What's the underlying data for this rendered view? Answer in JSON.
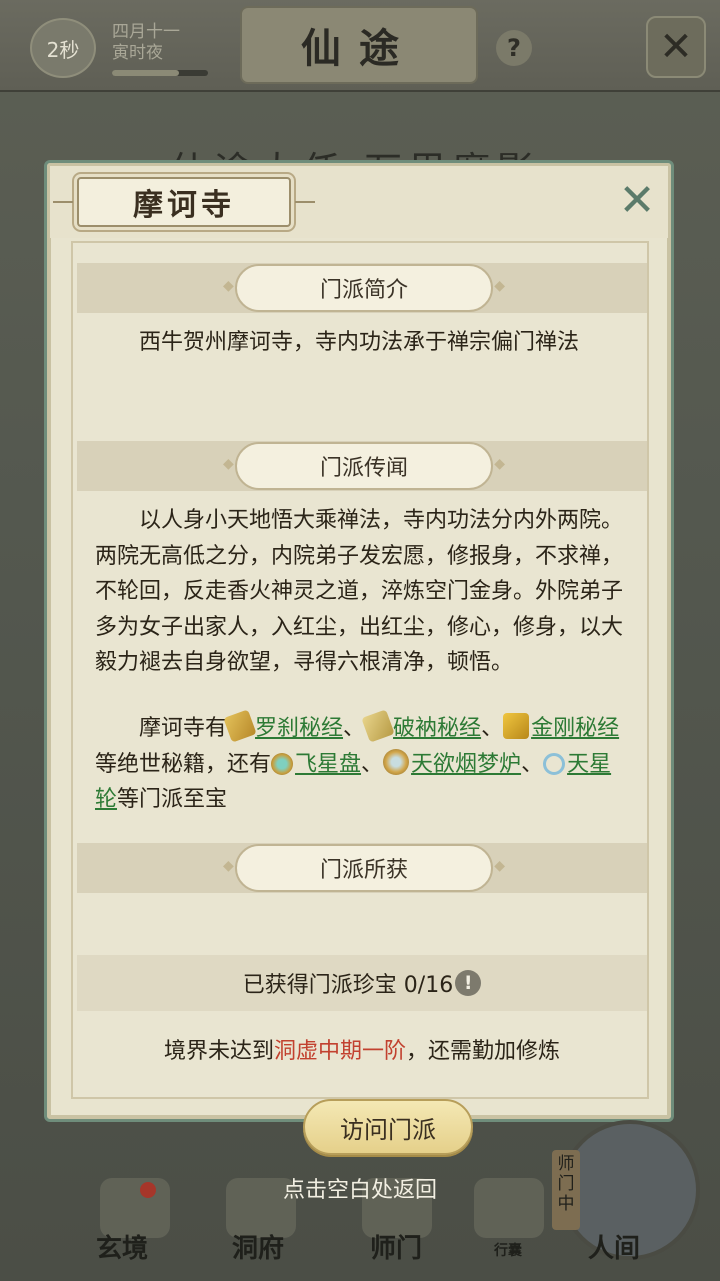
{
  "header": {
    "timer": "2秒",
    "date_line1": "四月十一",
    "date_line2": "寅时夜",
    "title": "仙途",
    "help": "?",
    "close": "✕"
  },
  "background": {
    "heading": "仙途大任 万里魔影"
  },
  "modal": {
    "title": "摩诃寺",
    "close": "✕",
    "sections": {
      "intro": {
        "label": "门派简介",
        "text": "西牛贺州摩诃寺，寺内功法承于禅宗偏门禅法"
      },
      "lore": {
        "label": "门派传闻",
        "text": "以人身小天地悟大乘禅法，寺内功法分内外两院。两院无高低之分，内院弟子发宏愿，修报身，不求禅，不轮回，反走香火神灵之道，淬炼空门金身。外院弟子多为女子出家人，入红尘，出红尘，修心，修身，以大毅力褪去自身欲望，寻得六根清净，顿悟。",
        "treasure_prefix": "摩诃寺有",
        "scrolls": [
          "罗刹秘经",
          "破衲秘经",
          "金刚秘经"
        ],
        "mid_text": "等绝世秘籍，还有",
        "treasures": [
          "飞星盘",
          "天欲烟梦炉",
          "天星轮"
        ],
        "end_text": "等门派至宝",
        "sep": "、"
      },
      "gains": {
        "label": "门派所获",
        "text": "已获得门派珍宝 0/16",
        "warn": "!"
      }
    },
    "realm": {
      "prefix": "境界未达到",
      "required": "洞虚中期一阶",
      "suffix": "，还需勤加修炼"
    },
    "visit_button": "访问门派"
  },
  "bottom": {
    "back_hint": "点击空白处返回",
    "nav": [
      "玄境",
      "洞府",
      "师门",
      "行囊",
      "人间"
    ],
    "side_tag": "师门中"
  }
}
